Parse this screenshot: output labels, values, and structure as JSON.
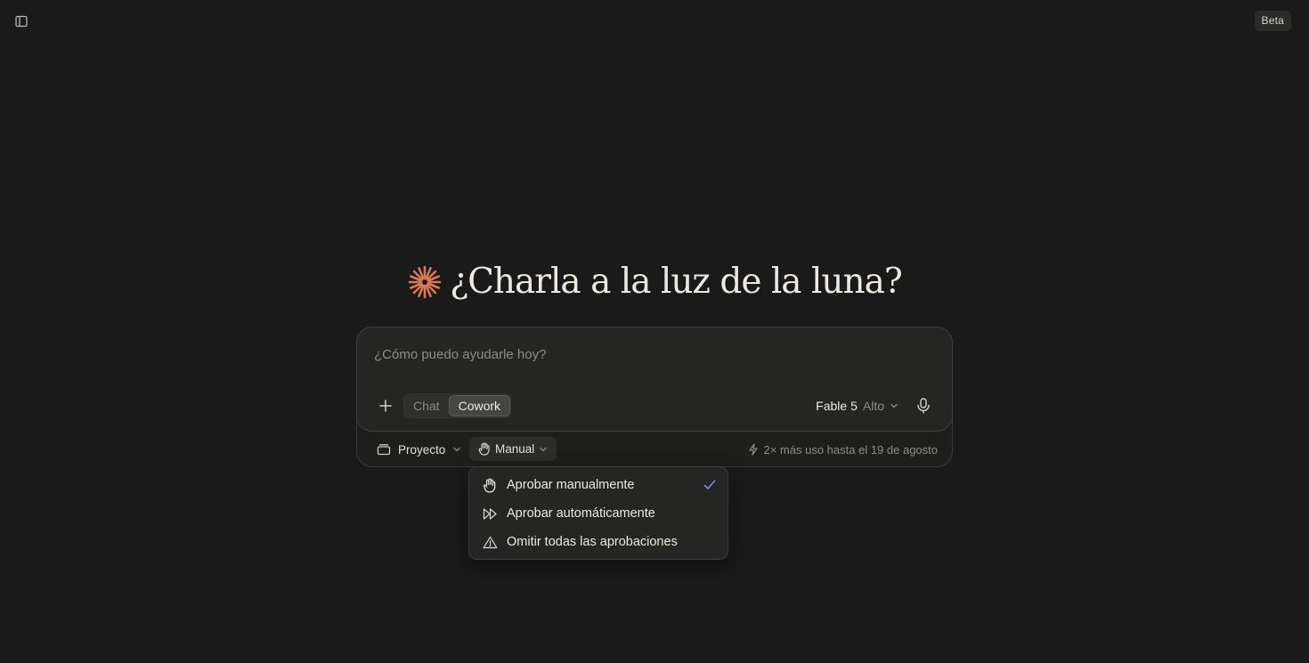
{
  "header": {
    "beta_label": "Beta"
  },
  "greeting": {
    "text": "¿Charla a la luz de la luna?",
    "logo_color": "#d97757"
  },
  "composer": {
    "placeholder": "¿Cómo puedo ayudarle hoy?",
    "value": "",
    "mode_tabs": [
      {
        "label": "Chat",
        "active": false
      },
      {
        "label": "Cowork",
        "active": true
      }
    ],
    "model": {
      "name": "Fable 5",
      "effort": "Alto"
    }
  },
  "bottom_bar": {
    "project_label": "Proyecto",
    "approval_label": "Manual",
    "usage_note": "2× más uso hasta el 19 de agosto"
  },
  "approval_menu": {
    "items": [
      {
        "label": "Aprobar manualmente",
        "icon": "hand-icon",
        "selected": true
      },
      {
        "label": "Aprobar automáticamente",
        "icon": "fast-forward-icon",
        "selected": false
      },
      {
        "label": "Omitir todas las aprobaciones",
        "icon": "warning-icon",
        "selected": false
      }
    ]
  },
  "colors": {
    "background": "#1a1a1a",
    "accent_check": "#6d8fe8",
    "brand": "#d97757"
  }
}
